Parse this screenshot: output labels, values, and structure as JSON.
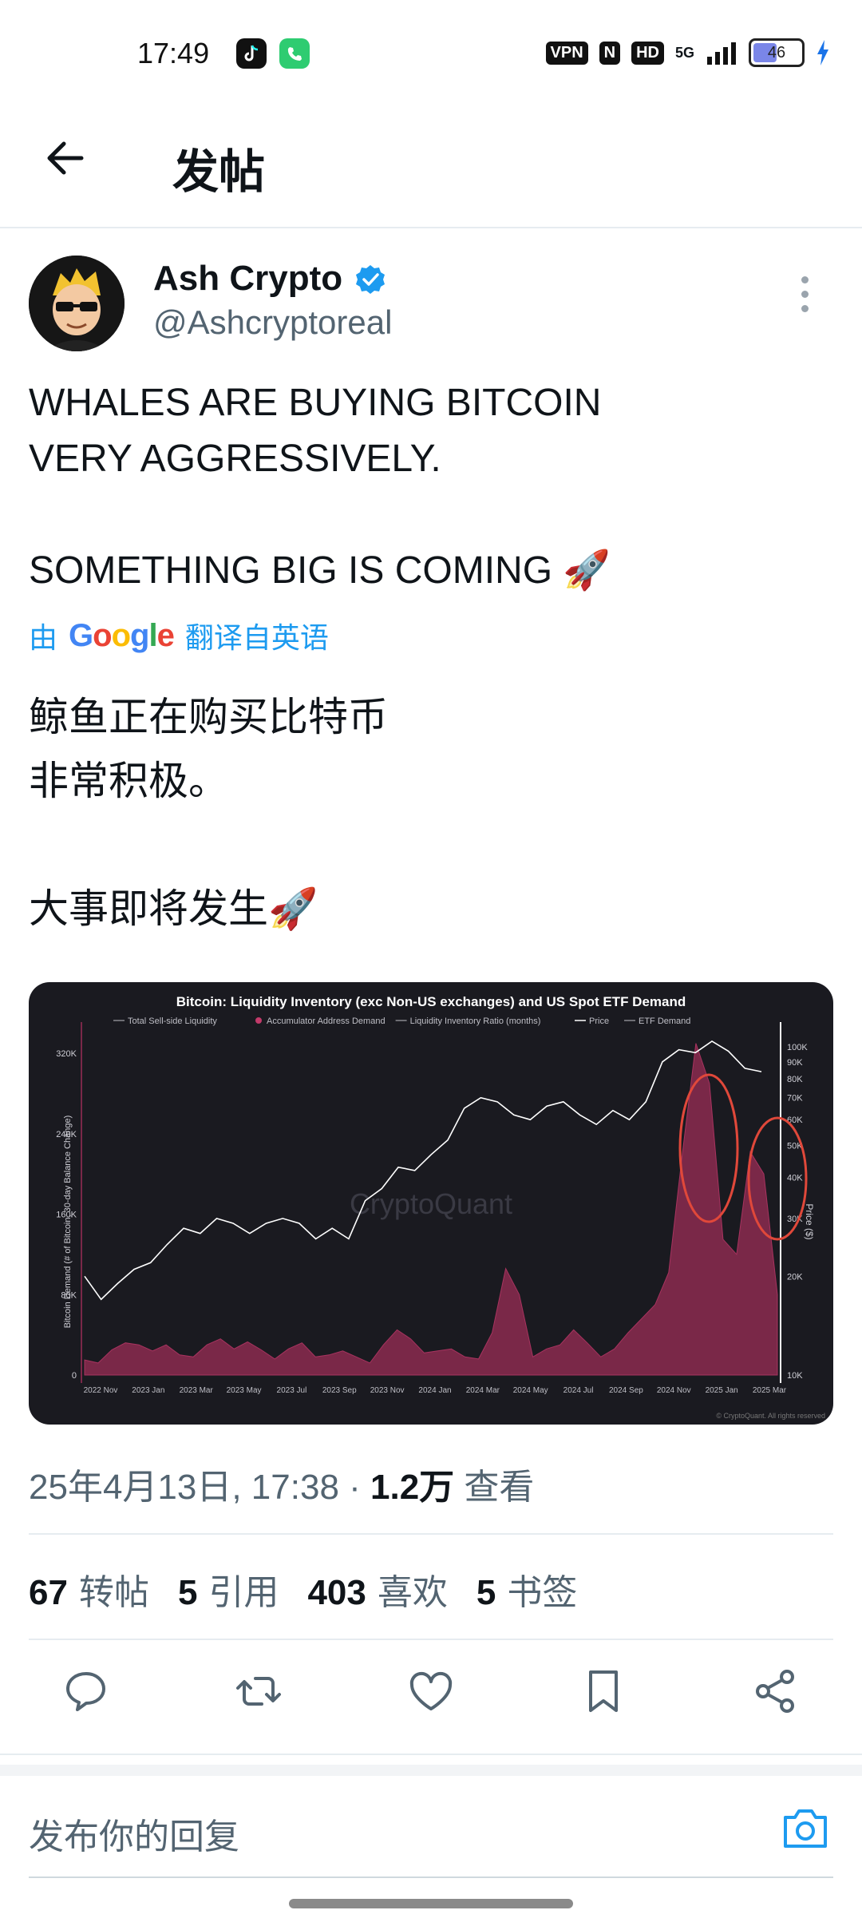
{
  "status_bar": {
    "time": "17:49",
    "vpn": "VPN",
    "nfc": "N",
    "hd": "HD",
    "network": "5G",
    "battery": "46"
  },
  "header": {
    "title": "发帖"
  },
  "tweet": {
    "author_name": "Ash Crypto",
    "handle": "@Ashcryptoreal",
    "text": "WHALES ARE BUYING BITCOIN\nVERY AGGRESSIVELY.\n\nSOMETHING BIG IS COMING 🚀",
    "translate_prefix": "由",
    "translate_brand": "Google",
    "translate_suffix": "翻译自英语",
    "translated_text": "鲸鱼正在购买比特币\n非常积极。\n\n大事即将发生🚀",
    "timestamp": "25年4月13日, 17:38 · ",
    "views": "1.2万",
    "views_label": " 查看"
  },
  "stats": [
    {
      "count": "67",
      "label": "转帖"
    },
    {
      "count": "5",
      "label": "引用"
    },
    {
      "count": "403",
      "label": "喜欢"
    },
    {
      "count": "5",
      "label": "书签"
    }
  ],
  "reply": {
    "placeholder": "发布你的回复"
  },
  "colors": {
    "accent": "#1d9bf0",
    "chart_bg": "#1a1a20",
    "demand_fill": "#7a2848",
    "circle": "#e0483a"
  },
  "icons": [
    "back-arrow-icon",
    "verified-badge-icon",
    "more-icon",
    "reply-icon",
    "retweet-icon",
    "like-icon",
    "bookmark-icon",
    "share-icon",
    "camera-icon"
  ],
  "chart_data": {
    "type": "area",
    "title": "Bitcoin: Liquidity Inventory (exc Non-US exchanges) and US Spot ETF Demand",
    "legend": [
      "Total Sell-side Liquidity",
      "Accumulator Address Demand",
      "Liquidity Inventory Ratio (months)",
      "Price",
      "ETF Demand"
    ],
    "ylabel": "Bitcoin Demand (# of Bitcoin, 30-day Balance Change)",
    "y2label": "Price ($)",
    "x_ticks": [
      "2022 Nov",
      "2023 Jan",
      "2023 Mar",
      "2023 May",
      "2023 Jul",
      "2023 Sep",
      "2023 Nov",
      "2024 Jan",
      "2024 Mar",
      "2024 May",
      "2024 Jul",
      "2024 Sep",
      "2024 Nov",
      "2025 Jan",
      "2025 Mar"
    ],
    "y_ticks": [
      "0",
      "80K",
      "160K",
      "240K",
      "320K"
    ],
    "y2_ticks": [
      "10K",
      "20K",
      "30K",
      "40K",
      "50K",
      "60K",
      "70K",
      "80K",
      "90K",
      "100K"
    ],
    "ylim": [
      0,
      340000
    ],
    "y2lim": [
      10000,
      110000
    ],
    "y2_scale": "log",
    "watermark": "CryptoQuant",
    "source": "© CryptoQuant. All rights reserved",
    "series": [
      {
        "name": "Accumulator Address Demand",
        "values": [
          15000,
          12000,
          25000,
          32000,
          30000,
          24000,
          30000,
          20000,
          18000,
          30000,
          36000,
          26000,
          33000,
          25000,
          16000,
          26000,
          32000,
          18000,
          20000,
          24000,
          18000,
          12000,
          30000,
          45000,
          36000,
          22000,
          24000,
          26000,
          18000,
          16000,
          42000,
          106000,
          80000,
          18000,
          26000,
          30000,
          45000,
          32000,
          18000,
          26000,
          42000,
          56000,
          70000,
          102000,
          220000,
          330000,
          290000,
          135000,
          120000,
          222000,
          200000,
          80000
        ]
      },
      {
        "name": "Price",
        "values": [
          20000,
          17000,
          19000,
          21000,
          22000,
          25000,
          28000,
          27000,
          30000,
          29000,
          27000,
          29000,
          30000,
          29000,
          26000,
          28000,
          26000,
          34000,
          37000,
          43000,
          42000,
          47000,
          52000,
          65000,
          70000,
          68000,
          62000,
          60000,
          66000,
          68000,
          62000,
          58000,
          64000,
          60000,
          68000,
          90000,
          98000,
          96000,
          104000,
          97000,
          86000,
          84000
        ]
      }
    ]
  }
}
